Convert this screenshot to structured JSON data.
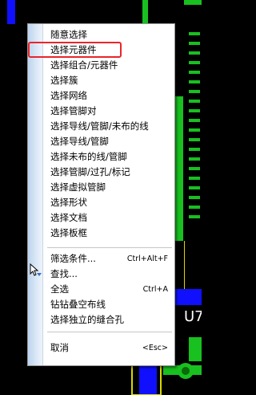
{
  "menu": {
    "items": [
      {
        "label": "随意选择"
      },
      {
        "label": "选择元器件"
      },
      {
        "label": "选择组合/元器件"
      },
      {
        "label": "选择簇"
      },
      {
        "label": "选择网络"
      },
      {
        "label": "选择管脚对"
      },
      {
        "label": "选择导线/管脚/未布的线"
      },
      {
        "label": "选择导线/管脚"
      },
      {
        "label": "选择未布的线/管脚"
      },
      {
        "label": "选择管脚/过孔/标记"
      },
      {
        "label": "选择虚拟管脚"
      },
      {
        "label": "选择形状"
      },
      {
        "label": "选择文档"
      },
      {
        "label": "选择板框"
      },
      {
        "label": "筛选条件...",
        "shortcut": "Ctrl+Alt+F"
      },
      {
        "label": "查找..."
      },
      {
        "label": "全选",
        "shortcut": "Ctrl+A"
      },
      {
        "label": "钻钻叠空布线"
      },
      {
        "label": "选择独立的缝合孔"
      },
      {
        "label": "取消",
        "shortcut": "<Esc>"
      }
    ]
  },
  "background": {
    "partial_text": "U7"
  },
  "colors": {
    "pcb_background": "#000000",
    "trace_green": "#18c020",
    "trace_blue": "#1010ff",
    "pad_yellow": "#d8d800",
    "highlight_red": "#e8262b"
  }
}
